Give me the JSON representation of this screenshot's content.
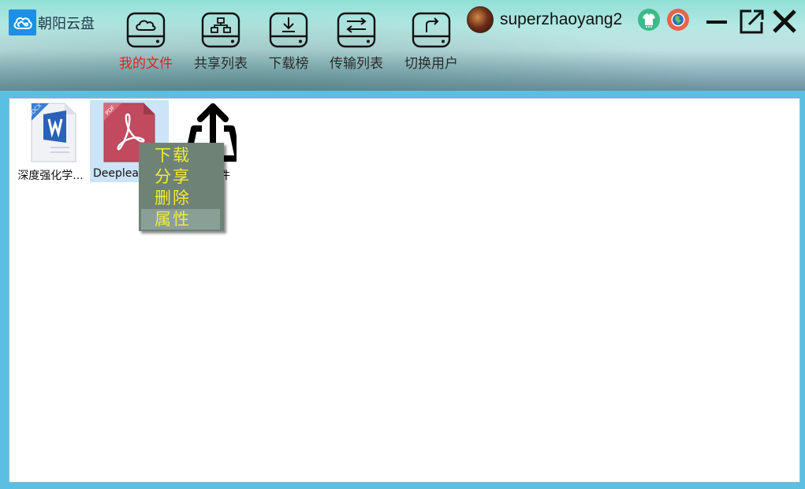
{
  "app": {
    "title": "朝阳云盘"
  },
  "toolbar": [
    {
      "label": "我的文件",
      "icon": "cloud-drive-icon",
      "active": true
    },
    {
      "label": "共享列表",
      "icon": "share-drive-icon",
      "active": false
    },
    {
      "label": "下载榜",
      "icon": "download-drive-icon",
      "active": false
    },
    {
      "label": "传输列表",
      "icon": "transfer-drive-icon",
      "active": false
    },
    {
      "label": "切换用户",
      "icon": "switch-user-drive-icon",
      "active": false
    }
  ],
  "user": {
    "name": "superzhaoyang2"
  },
  "files": [
    {
      "name": "深度强化学...",
      "type": "docx",
      "badge": "DOCX"
    },
    {
      "name": "Deeplea",
      "type": "pdf",
      "badge": "PDF",
      "selected": true
    },
    {
      "name": "件",
      "type": "upload",
      "icon": "upload-icon"
    }
  ],
  "context_menu": {
    "items": [
      "下载",
      "分享",
      "删除",
      "属性"
    ],
    "highlighted": "属性"
  },
  "colors": {
    "active_label": "#e02020",
    "menu_bg": "#6e8276",
    "menu_text": "#f2ea3a",
    "selection": "#cce4f7",
    "frame": "#5bbfe3"
  }
}
